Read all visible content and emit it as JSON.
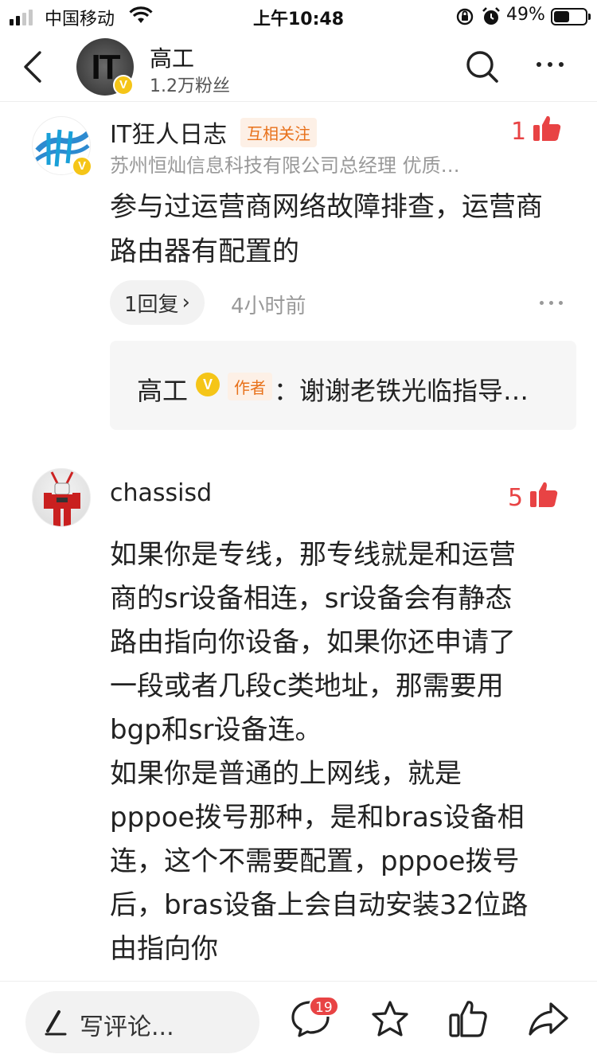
{
  "status_bar": {
    "carrier": "中国移动",
    "time": "上午10:48",
    "battery_percent": "49%",
    "battery_level": 0.49,
    "signal_bars": 2
  },
  "header": {
    "title": "高工",
    "followers": "1.2万粉丝",
    "avatar_text": "IT",
    "verified": "V"
  },
  "comments": [
    {
      "author": "IT狂人日志",
      "tag": "互相关注",
      "subtitle": "苏州恒灿信息科技有限公司总经理 优质…",
      "likes": "1",
      "body": "参与过运营商网络故障排查，运营商路由器有配置的",
      "reply_count": "1回复",
      "reply_chevron": "›",
      "time": "4小时前",
      "verified": "V",
      "reply": {
        "author": "高工",
        "verified": "V",
        "badge": "作者",
        "text": "：谢谢老铁光临指导…"
      }
    },
    {
      "author": "chassisd",
      "likes": "5",
      "body_lines": [
        "如果你是专线，那专线就是和运营",
        "商的sr设备相连，sr设备会有静态",
        "路由指向你设备，如果你还申请了",
        "一段或者几段c类地址，那需要用",
        "bgp和sr设备连。",
        "如果你是普通的上网线，就是",
        "pppoe拨号那种，是和bras设备相",
        "连，这个不需要配置，pppoe拨号",
        "后，bras设备上会自动安装32位路",
        "由指向你"
      ]
    }
  ],
  "bottom_bar": {
    "write_placeholder": "写评论...",
    "comment_count": "19"
  },
  "colors": {
    "accent_red": "#e84344",
    "verified_gold": "#f5c518",
    "tag_orange": "#e8711a"
  },
  "icons": [
    "back-icon",
    "search-icon",
    "more-icon",
    "thumbs-up-icon",
    "pen-icon",
    "comment-icon",
    "star-icon",
    "share-icon"
  ]
}
